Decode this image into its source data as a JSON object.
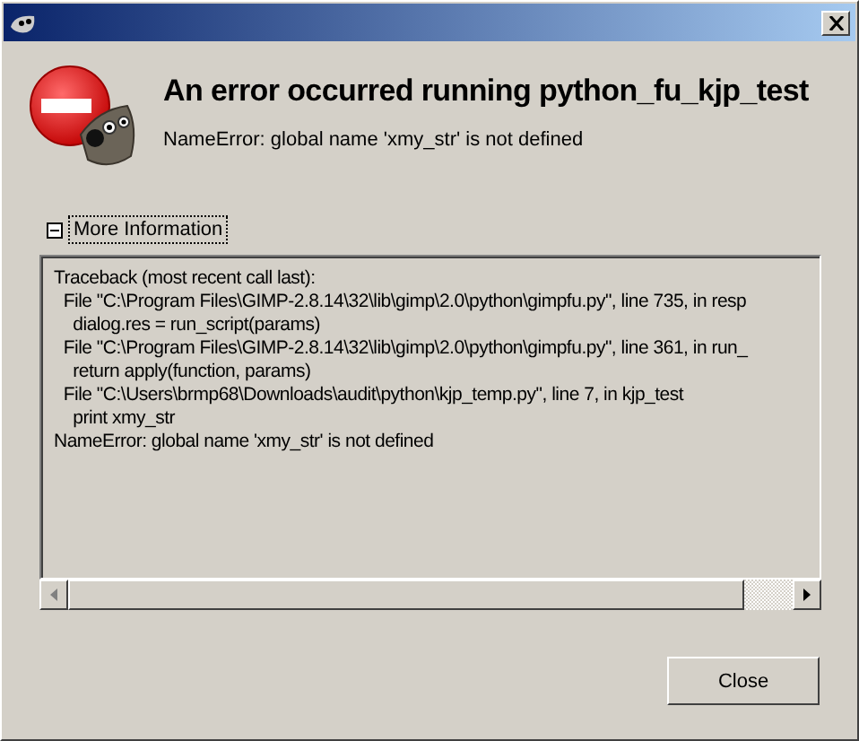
{
  "heading": "An error occurred running python_fu_kjp_test",
  "message": "NameError: global name 'xmy_str' is not defined",
  "expander": {
    "label": "More Information",
    "expanded": true
  },
  "details": [
    "Traceback (most recent call last):",
    "  File \"C:\\Program Files\\GIMP-2.8.14\\32\\lib\\gimp\\2.0\\python\\gimpfu.py\", line 735, in resp",
    "    dialog.res = run_script(params)",
    "  File \"C:\\Program Files\\GIMP-2.8.14\\32\\lib\\gimp\\2.0\\python\\gimpfu.py\", line 361, in run_",
    "    return apply(function, params)",
    "  File \"C:\\Users\\brmp68\\Downloads\\audit\\python\\kjp_temp.py\", line 7, in kjp_test",
    "    print xmy_str",
    "NameError: global name 'xmy_str' is not defined"
  ],
  "buttons": [
    "Close"
  ]
}
